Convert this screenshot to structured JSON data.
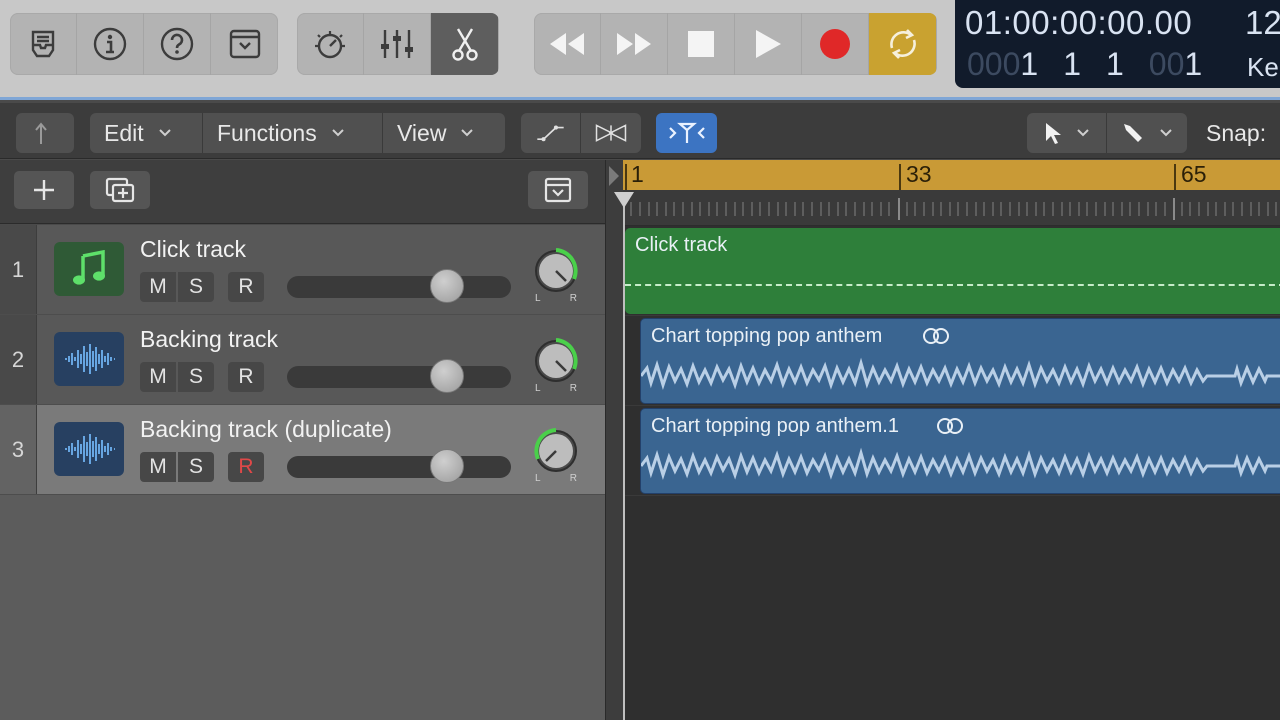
{
  "control_bar": {
    "lcd": {
      "time": "01:00:00:00.00",
      "bars_dim1": "000",
      "bar": "1",
      "beat": "1",
      "division": "1",
      "bars_dim2": "00",
      "tick": "1",
      "tempo": "12",
      "key": "Ke"
    },
    "colors": {
      "cycle_active": "#c9a230",
      "record": "#e02828",
      "lcd_bg": "#111b2b"
    }
  },
  "toolbar": {
    "menus": {
      "edit": "Edit",
      "functions": "Functions",
      "view": "View"
    },
    "snap_label": "Snap:"
  },
  "ruler": {
    "bars": [
      "1",
      "33",
      "65"
    ]
  },
  "tracks": [
    {
      "number": "1",
      "name": "Click track",
      "mute": "M",
      "solo": "S",
      "record": "R",
      "record_armed": false,
      "icon": "music-note-icon"
    },
    {
      "number": "2",
      "name": "Backing track",
      "mute": "M",
      "solo": "S",
      "record": "R",
      "record_armed": false,
      "icon": "waveform-icon"
    },
    {
      "number": "3",
      "name": "Backing track (duplicate)",
      "mute": "M",
      "solo": "S",
      "record": "R",
      "record_armed": true,
      "icon": "waveform-icon"
    }
  ],
  "pan_labels": {
    "left": "L",
    "right": "R"
  },
  "regions": [
    {
      "name": "Click track",
      "color": "#2e7f3a"
    },
    {
      "name": "Chart topping pop anthem",
      "color": "#3a6591"
    },
    {
      "name": "Chart topping pop anthem.1",
      "color": "#3a6591"
    }
  ]
}
